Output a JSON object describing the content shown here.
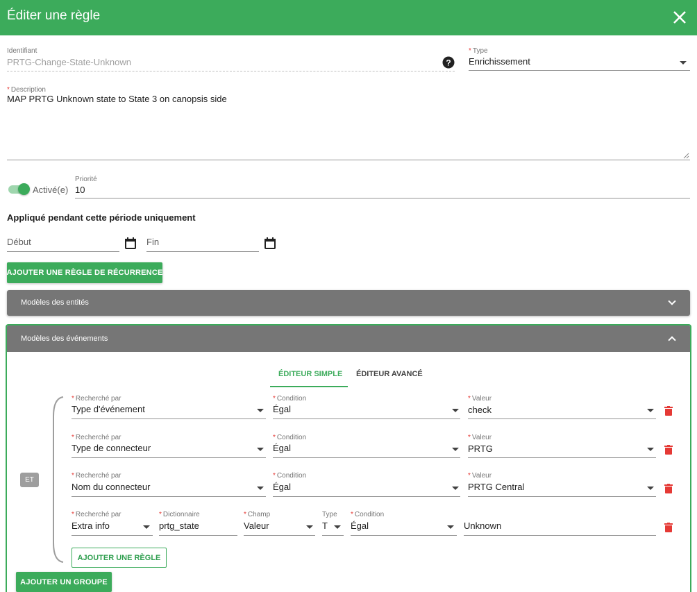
{
  "dialog": {
    "title": "Éditer une règle",
    "close_icon": "close-icon"
  },
  "form": {
    "identifier": {
      "label": "Identifiant",
      "value": "PRTG-Change-State-Unknown"
    },
    "type": {
      "label": "Type",
      "value": "Enrichissement"
    },
    "description": {
      "label": "Description",
      "value": "MAP PRTG Unknown state to State 3 on canopsis side"
    },
    "enabled": {
      "label": "Activé(e)",
      "on": true
    },
    "priority": {
      "label": "Priorité",
      "value": "10"
    },
    "period": {
      "heading": "Appliqué pendant cette période uniquement",
      "start_label": "Début",
      "end_label": "Fin"
    },
    "add_recurrence_label": "AJOUTER UNE RÈGLE DE RÉCURRENCE"
  },
  "panels": {
    "entities": {
      "title": "Modèles des entités"
    },
    "events": {
      "title": "Modèles des événements"
    }
  },
  "tabs": [
    {
      "label": "ÉDITEUR SIMPLE",
      "active": true
    },
    {
      "label": "ÉDITEUR AVANCÉ",
      "active": false
    }
  ],
  "group": {
    "operator": "ET",
    "rules": [
      {
        "field_label": "Recherché par",
        "field": "Type d'événement",
        "cond_label": "Condition",
        "cond": "Égal",
        "value_label": "Valeur",
        "value": "check"
      },
      {
        "field_label": "Recherché par",
        "field": "Type de connecteur",
        "cond_label": "Condition",
        "cond": "Égal",
        "value_label": "Valeur",
        "value": "PRTG"
      },
      {
        "field_label": "Recherché par",
        "field": "Nom du connecteur",
        "cond_label": "Condition",
        "cond": "Égal",
        "value_label": "Valeur",
        "value": "PRTG Central"
      }
    ],
    "extra": {
      "field_label": "Recherché par",
      "field": "Extra info",
      "dict_label": "Dictionnaire",
      "dict": "prtg_state",
      "champ_label": "Champ",
      "champ": "Valeur",
      "type_label": "Type",
      "type": "T",
      "cond_label": "Condition",
      "cond": "Égal",
      "value": "Unknown"
    },
    "add_rule_label": "AJOUTER UNE RÈGLE"
  },
  "add_group_label": "AJOUTER UN GROUPE",
  "colors": {
    "primary": "#3cab5b",
    "danger": "#e53935",
    "panel": "#767676"
  }
}
